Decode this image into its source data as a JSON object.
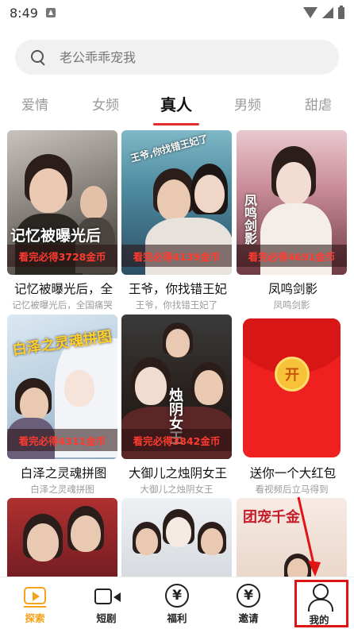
{
  "status_bar": {
    "time": "8:49"
  },
  "search": {
    "placeholder": "老公乖乖宠我"
  },
  "tabs": [
    {
      "label": "爱情"
    },
    {
      "label": "女频"
    },
    {
      "label": "真人"
    },
    {
      "label": "男频"
    },
    {
      "label": "甜虐"
    }
  ],
  "active_tab": "真人",
  "cards": [
    {
      "title": "记忆被曝光后，全",
      "subtitle": "记忆被曝光后，全国痛哭",
      "reward": "看完必得3728金币",
      "poster_text": "记忆被曝光后"
    },
    {
      "title": "王爷，你找错王妃",
      "subtitle": "王爷，你找错王妃了",
      "reward": "看完必得4139金币",
      "poster_text": "王爷,你找错王妃了"
    },
    {
      "title": "凤鸣剑影",
      "subtitle": "凤鸣剑影",
      "reward": "看完必得4691金币",
      "poster_text": "凤鸣剑影"
    },
    {
      "title": "白泽之灵魂拼图",
      "subtitle": "白泽之灵魂拼图",
      "reward": "看完必得4311金币",
      "poster_text": "白泽之灵魂拼图"
    },
    {
      "title": "大御儿之烛阴女王",
      "subtitle": "大御儿之烛阴女王",
      "reward": "看完必得3842金币",
      "poster_text": "烛阴女王"
    },
    {
      "title": "送你一个大红包",
      "subtitle": "看视频后立马得到",
      "red_packet_label": "开"
    },
    {
      "title": "",
      "subtitle": ""
    },
    {
      "title": "",
      "subtitle": ""
    },
    {
      "title": "",
      "subtitle": "",
      "poster_text": "团宠千金"
    }
  ],
  "bottom_nav": [
    {
      "label": "探索",
      "icon": "play-square-icon",
      "active": true
    },
    {
      "label": "短剧",
      "icon": "video-camera-icon",
      "active": false
    },
    {
      "label": "福利",
      "icon": "yen-coin-icon",
      "active": false
    },
    {
      "label": "邀请",
      "icon": "yen-coin-icon",
      "active": false
    },
    {
      "label": "我的",
      "icon": "user-icon",
      "active": false
    }
  ],
  "yen_glyph": "¥",
  "colors": {
    "accent": "#f5a11a",
    "tab_underline": "#e22b2b",
    "reward_text": "#ff3b30",
    "highlight": "#e11414"
  }
}
